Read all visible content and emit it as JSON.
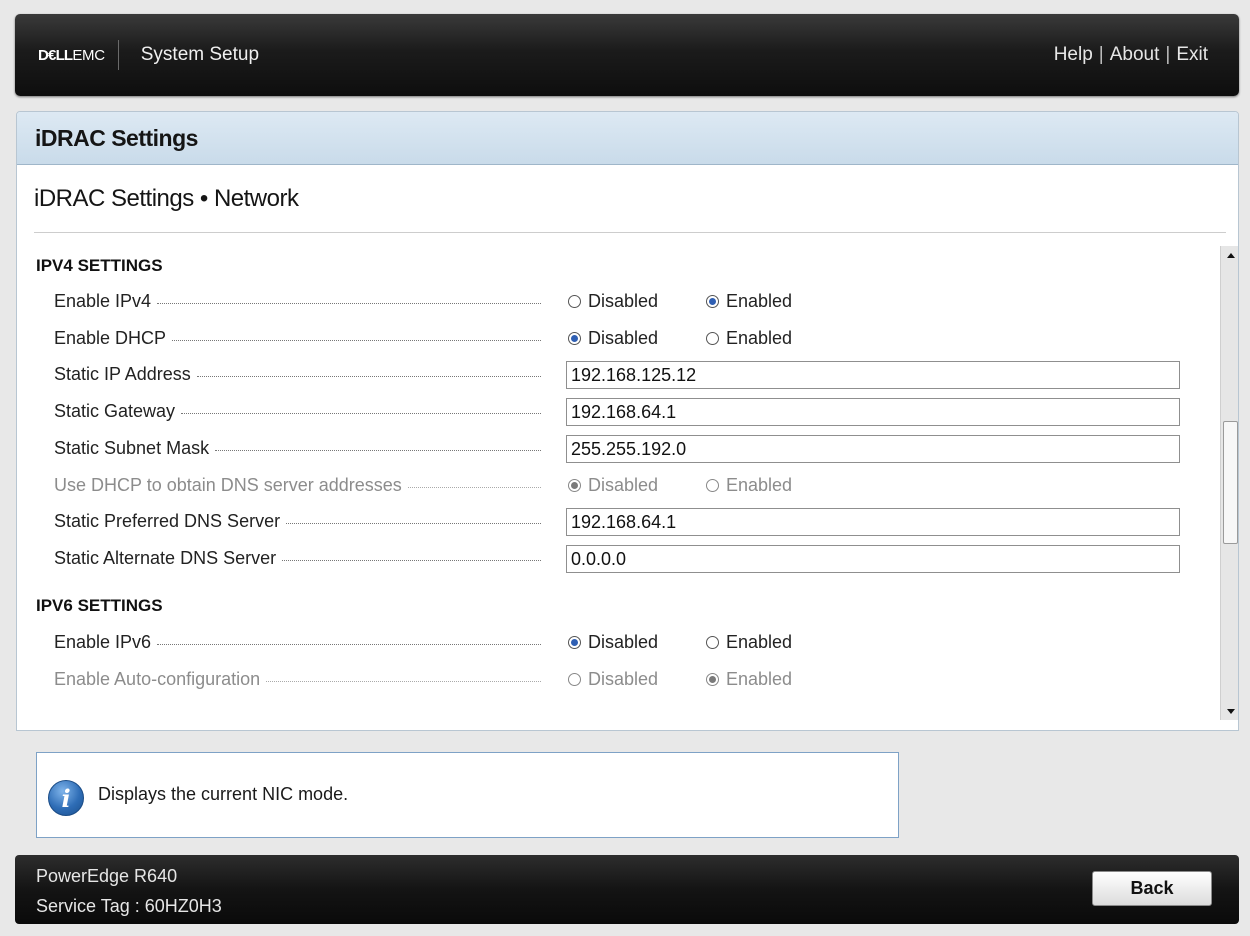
{
  "header": {
    "logo_dell": "D€LL",
    "logo_emc": "EMC",
    "title": "System Setup",
    "nav": [
      {
        "label": "Help"
      },
      {
        "label": "About"
      },
      {
        "label": "Exit"
      }
    ],
    "nav_separator": "|"
  },
  "panel": {
    "header": "iDRAC Settings",
    "page_title": "iDRAC Settings • Network"
  },
  "ipv4": {
    "title": "IPV4 SETTINGS",
    "enable_ipv4": {
      "label": "Enable IPv4",
      "options": [
        "Disabled",
        "Enabled"
      ],
      "selected": "Enabled"
    },
    "enable_dhcp": {
      "label": "Enable DHCP",
      "options": [
        "Disabled",
        "Enabled"
      ],
      "selected": "Disabled"
    },
    "static_ip": {
      "label": "Static IP Address",
      "value": "192.168.125.12"
    },
    "static_gateway": {
      "label": "Static Gateway",
      "value": "192.168.64.1"
    },
    "static_subnet": {
      "label": "Static Subnet Mask",
      "value": "255.255.192.0"
    },
    "dhcp_dns": {
      "label": "Use DHCP to obtain DNS server addresses",
      "options": [
        "Disabled",
        "Enabled"
      ],
      "selected": "Disabled",
      "disabled": true
    },
    "preferred_dns": {
      "label": "Static Preferred DNS Server",
      "value": "192.168.64.1"
    },
    "alternate_dns": {
      "label": "Static Alternate DNS Server",
      "value": "0.0.0.0"
    }
  },
  "ipv6": {
    "title": "IPV6 SETTINGS",
    "enable_ipv6": {
      "label": "Enable IPv6",
      "options": [
        "Disabled",
        "Enabled"
      ],
      "selected": "Disabled"
    },
    "auto_config": {
      "label": "Enable Auto-configuration",
      "options": [
        "Disabled",
        "Enabled"
      ],
      "selected": "Enabled",
      "disabled": true
    }
  },
  "help": {
    "icon": "info-icon",
    "icon_glyph": "i",
    "text": "Displays the current NIC mode."
  },
  "footer": {
    "model": "PowerEdge R640",
    "service_tag": "Service Tag : 60HZ0H3",
    "back_label": "Back"
  },
  "colors": {
    "accent": "#2f5fb3",
    "header_bg": "#1b1b1b",
    "panel_header_bg": "#c9dbea"
  }
}
